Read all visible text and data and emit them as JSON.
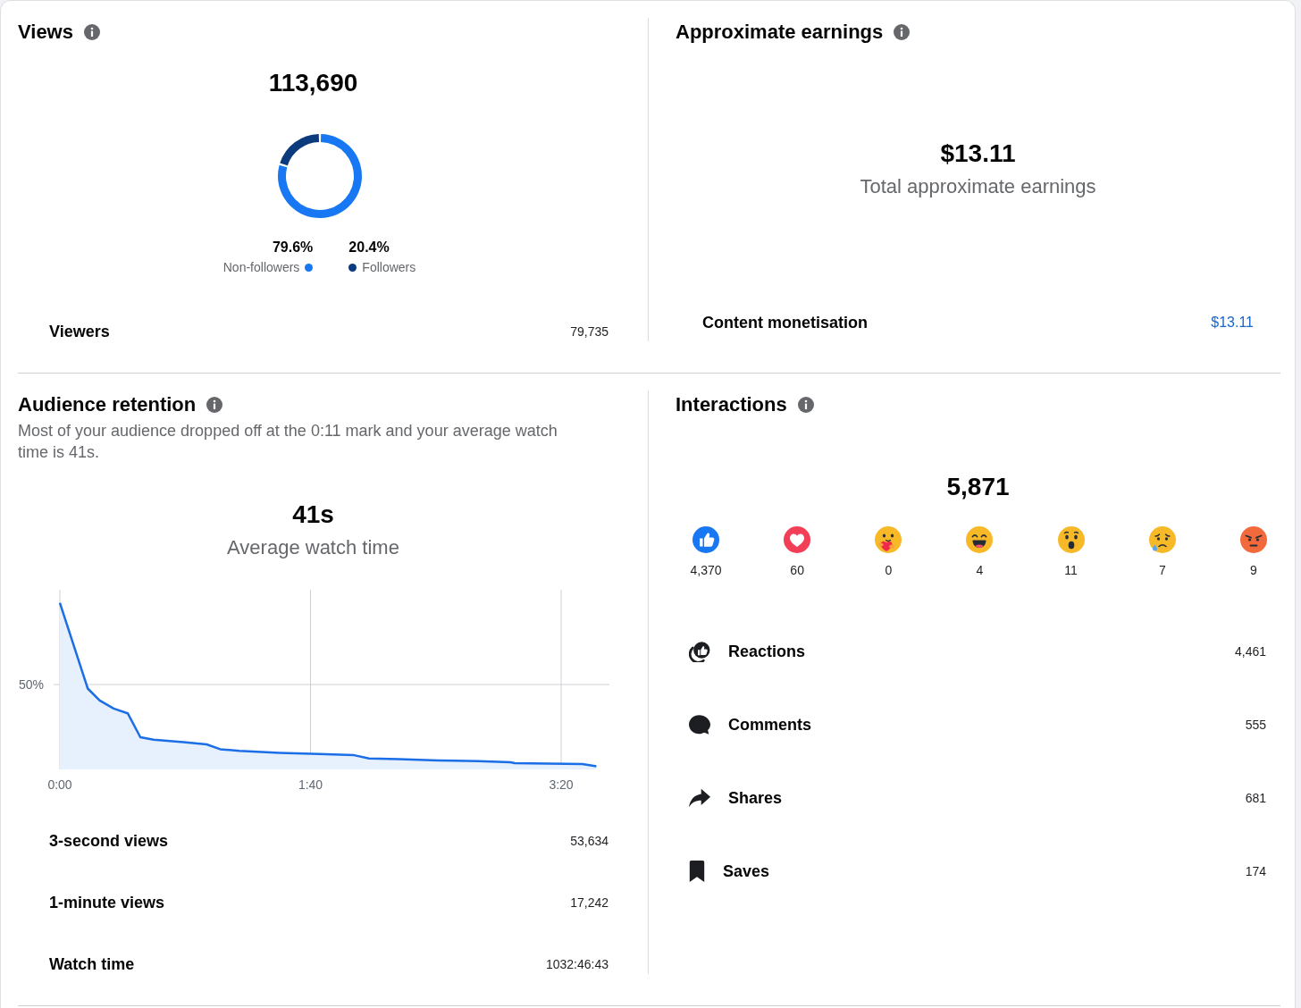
{
  "views": {
    "title": "Views",
    "total": "113,690",
    "chart_data": {
      "type": "donut",
      "categories": [
        "Non-followers",
        "Followers"
      ],
      "values": [
        79.6,
        20.4
      ]
    },
    "legend": [
      {
        "value": "79.6%",
        "color": "#1877f2"
      },
      {
        "value": "20.4%",
        "color": "#0b3b7d"
      }
    ],
    "rows": [
      {
        "label": "Viewers",
        "value": "79,735"
      }
    ]
  },
  "earnings": {
    "title": "Approximate earnings",
    "total": "$13.11",
    "caption": "Total approximate earnings",
    "rows": [
      {
        "label": "Content monetisation",
        "value": "$13.11"
      }
    ]
  },
  "retention": {
    "title": "Audience retention",
    "description": "Most of your audience dropped off at the 0:11 mark and your average watch time is 41s.",
    "total": "41s",
    "caption": "Average watch time",
    "chart": {
      "y_tick_labels": [
        "50%"
      ],
      "x_tick_labels": [
        "0:00",
        "1:40",
        "3:20"
      ]
    },
    "rows": [
      {
        "label": "3-second views",
        "value": "53,634"
      },
      {
        "label": "1-minute views",
        "value": "17,242"
      },
      {
        "label": "Watch time",
        "value": "1032:46:43"
      }
    ]
  },
  "interactions": {
    "title": "Interactions",
    "total": "5,871",
    "reactions": [
      {
        "kind": "like",
        "count": "4,370"
      },
      {
        "kind": "love",
        "count": "60"
      },
      {
        "kind": "care",
        "count": "0"
      },
      {
        "kind": "haha",
        "count": "4"
      },
      {
        "kind": "wow",
        "count": "11"
      },
      {
        "kind": "sad",
        "count": "7"
      },
      {
        "kind": "angry",
        "count": "9"
      }
    ],
    "rows": [
      {
        "kind": "reactions",
        "label": "Reactions",
        "value": "4,461"
      },
      {
        "kind": "comments",
        "label": "Comments",
        "value": "555"
      },
      {
        "kind": "shares",
        "label": "Shares",
        "value": "681"
      },
      {
        "kind": "saves",
        "label": "Saves",
        "value": "174"
      }
    ]
  }
}
